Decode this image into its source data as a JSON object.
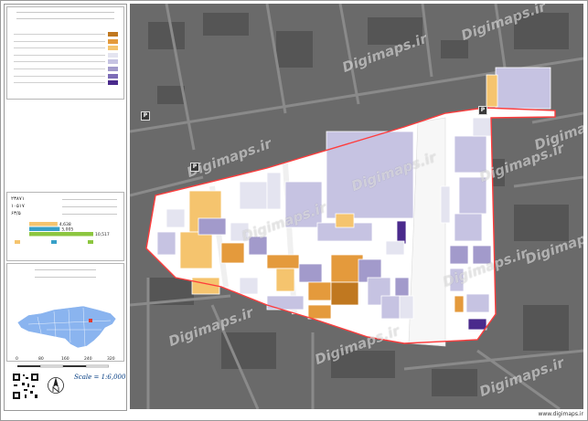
{
  "legend": {
    "items": [
      {
        "color": "#c07820",
        "label": ""
      },
      {
        "color": "#e49a3c",
        "label": ""
      },
      {
        "color": "#f5c46e",
        "label": ""
      },
      {
        "color": "#e4e4f0",
        "label": ""
      },
      {
        "color": "#c6c3e2",
        "label": ""
      },
      {
        "color": "#a29acb",
        "label": ""
      },
      {
        "color": "#7c6cb6",
        "label": ""
      },
      {
        "color": "#4a2a8c",
        "label": ""
      }
    ]
  },
  "stats": {
    "values": [
      {
        "value": "۲۳۸۷۱"
      },
      {
        "value": "۱۰۵۱۷"
      },
      {
        "value": "۶۳/۵"
      }
    ]
  },
  "bar_chart": {
    "values": [
      4638,
      5005,
      10517
    ]
  },
  "scale": {
    "label": "Scale = 1:6,000",
    "unit": "m",
    "ticks": [
      "0",
      "80",
      "160",
      "240",
      "320"
    ]
  },
  "watermarks": [
    "Digimaps.ir",
    "Digimaps.ir",
    "Digimaps.ir",
    "Digimaps.ir",
    "Digimaps.ir",
    "Digimaps.ir",
    "Digimaps.ir",
    "Digimaps.ir",
    "Digimaps.ir",
    "Digimaps.ir",
    "Digimaps.ir",
    "Digimaps.ir"
  ],
  "parking_label": "P",
  "footer": {
    "url": "www.digimaps.ir"
  },
  "colors": {
    "boundary": "#ff3c3c",
    "road": "#f2f2f2",
    "background": "#6a6a6a",
    "minimap": "#8ab4ef",
    "highlight": "#e33b2f"
  }
}
